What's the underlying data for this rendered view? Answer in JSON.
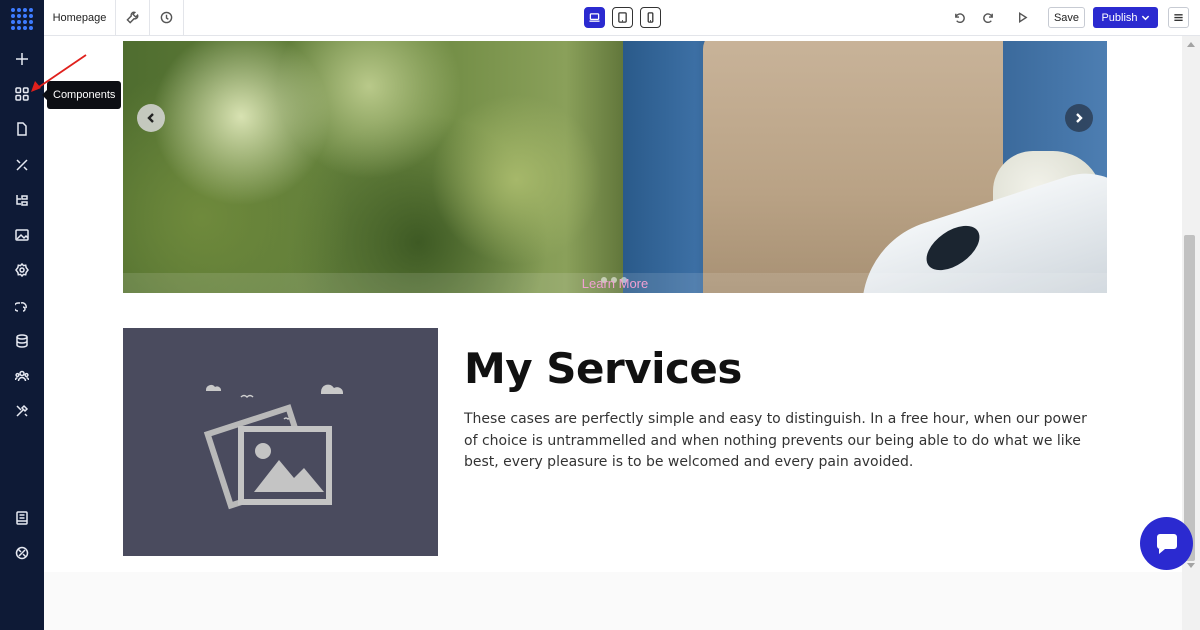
{
  "sidebar": {
    "items": [
      {
        "name": "add-icon"
      },
      {
        "name": "components-icon"
      },
      {
        "name": "page-icon"
      },
      {
        "name": "design-tools-icon"
      },
      {
        "name": "structure-icon"
      },
      {
        "name": "image-icon"
      },
      {
        "name": "settings-icon"
      },
      {
        "name": "integrations-icon"
      },
      {
        "name": "database-icon"
      },
      {
        "name": "users-icon"
      },
      {
        "name": "tools-icon"
      },
      {
        "name": "docs-icon"
      },
      {
        "name": "support-icon"
      }
    ]
  },
  "tooltip": {
    "label": "Components"
  },
  "toolbar": {
    "page_label": "Homepage",
    "save_label": "Save",
    "publish_label": "Publish",
    "devices": [
      "desktop",
      "tablet",
      "mobile"
    ],
    "active_device": "desktop"
  },
  "hero": {
    "cta_label": "Learn More",
    "slide_count": 3
  },
  "services": {
    "title": "My Services",
    "body": "These cases are perfectly simple and easy to distinguish. In a free hour, when our power of choice is untrammelled and when nothing prevents our being able to do what we like best, every pleasure is to be welcomed and every pain avoided."
  },
  "colors": {
    "sidebar_bg": "#0e1a36",
    "accent": "#2b2ad0",
    "cta_text": "#f0a0d2",
    "placeholder_bg": "#4a4b5e"
  }
}
